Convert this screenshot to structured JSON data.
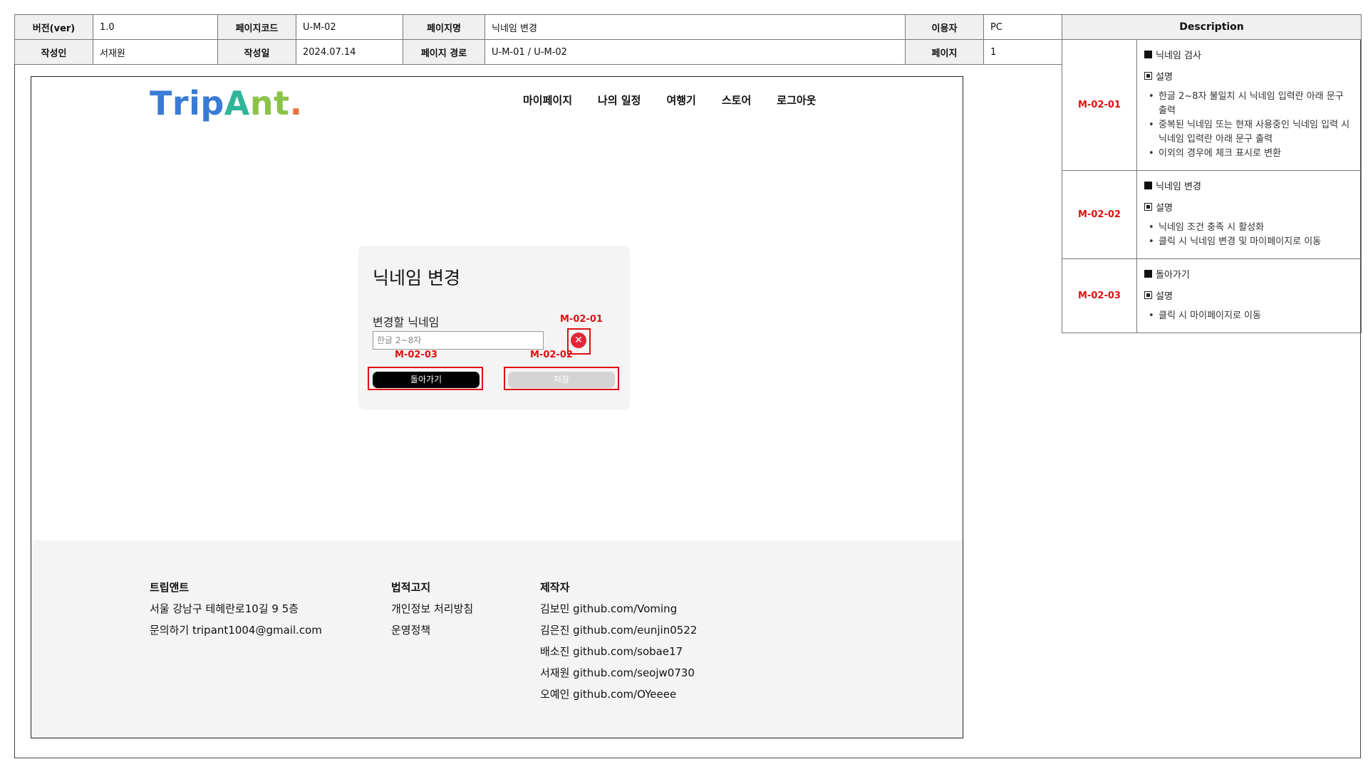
{
  "header": {
    "ver_label": "버전(ver)",
    "ver": "1.0",
    "code_label": "페이지코드",
    "code": "U-M-02",
    "name_label": "페이지명",
    "name": "닉네임 변경",
    "user_label": "이용자",
    "user": "PC",
    "author_label": "작성인",
    "author": "서재원",
    "date_label": "작성일",
    "date": "2024.07.14",
    "path_label": "페이지 경로",
    "path": "U-M-01 / U-M-02",
    "page_label": "페이지",
    "page": "1"
  },
  "description": {
    "title": "Description",
    "items": [
      {
        "id": "M-02-01",
        "heading": "닉네임 검사",
        "sub": "설명",
        "bullets": [
          "한글 2~8자 불일치 시 닉네임 입력란 아래 문구 출력",
          "중복된 닉네임 또는 현재 사용중인 닉네임 입력 시 닉네임 입력란 아래 문구 출력",
          "이외의 경우에 체크 표시로 변환"
        ]
      },
      {
        "id": "M-02-02",
        "heading": "닉네임 변경",
        "sub": "설명",
        "bullets": [
          "닉네임 조건 충족 시 활성화",
          "클릭 시 닉네임 변경 및 마이페이지로 이동"
        ]
      },
      {
        "id": "M-02-03",
        "heading": "돌아가기",
        "sub": "설명",
        "bullets": [
          "클릭 시 마이페이지로 이동"
        ]
      }
    ]
  },
  "mock": {
    "logo": "TripAnt.",
    "nav": [
      "마이페이지",
      "나의 일정",
      "여행기",
      "스토어",
      "로그아웃"
    ],
    "card": {
      "title": "닉네임 변경",
      "label": "변경할 닉네임",
      "placeholder": "한글 2~8자",
      "clear_glyph": "✕",
      "back": "돌아가기",
      "save": "저장"
    },
    "tags": {
      "check": "M-02-01",
      "save": "M-02-02",
      "back": "M-02-03"
    },
    "footer": {
      "col1": {
        "title": "트립앤트",
        "lines": [
          "서울 강남구 테헤란로10길 9 5층",
          "문의하기 tripant1004@gmail.com"
        ]
      },
      "col2": {
        "title": "법적고지",
        "lines": [
          "개인정보 처리방침",
          "운영정책"
        ]
      },
      "col3": {
        "title": "제작자",
        "lines": [
          "김보민 github.com/Voming",
          "김은진 github.com/eunjin0522",
          "배소진 github.com/sobae17",
          "서재원 github.com/seojw0730",
          "오예인 github.com/OYeeee"
        ]
      }
    }
  },
  "colors": {
    "accent_red": "#e01010",
    "logo_blue": "#3a7bd5",
    "logo_teal": "#2fb59a",
    "logo_green": "#8bc34a",
    "logo_orange": "#e8733a"
  }
}
